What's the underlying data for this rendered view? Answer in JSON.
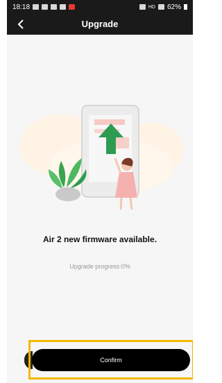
{
  "status_bar": {
    "time": "18:18",
    "signal": "HD",
    "battery": "62%"
  },
  "header": {
    "title": "Upgrade"
  },
  "main": {
    "firmware_message": "Air 2 new firmware available.",
    "progress_text": "Upgrade progress:0%",
    "progress_value": 0
  },
  "footer": {
    "confirm_label": "Confirm"
  },
  "colors": {
    "header_bg": "#1a1a1a",
    "page_bg": "#f6f6f6",
    "arrow_green": "#2e9b52",
    "highlight": "#f5b700",
    "button_bg": "#000000"
  },
  "icons": {
    "back": "chevron-left-icon",
    "upgrade_arrow": "up-arrow-icon"
  }
}
